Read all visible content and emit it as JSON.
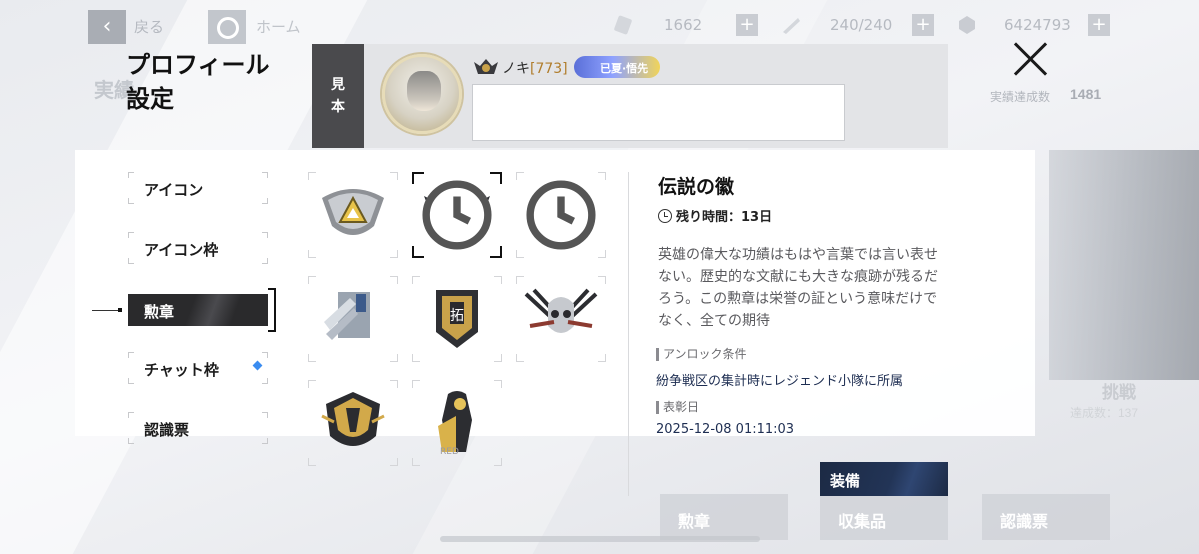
{
  "top_bar": {
    "back_label": "戻る",
    "home_label": "ホーム",
    "resource_1": "1662",
    "resource_2": "240/240",
    "resource_3": "6424793"
  },
  "background": {
    "left_title": "実績",
    "achievement_label": "実績達成数",
    "achievement_count": "1481",
    "challenge_label": "挑戦",
    "challenge_count_label": "達成数：137",
    "bottom_tabs": [
      "勲章",
      "収集品",
      "認識票"
    ]
  },
  "modal": {
    "title_line1": "プロフィール",
    "title_line2": "設定"
  },
  "preview": {
    "tag_line1": "見",
    "tag_line2": "本",
    "player_name": "ノキ",
    "player_level": "[773]",
    "rank_badge": "已夏·悟先"
  },
  "nav": {
    "items": [
      "アイコン",
      "アイコン枠",
      "勲章",
      "チャット枠",
      "認識票"
    ],
    "active_index": 2
  },
  "medals": [
    {
      "name": "medal-triangle-shield",
      "timed": false,
      "selected": false
    },
    {
      "name": "medal-legend-wings",
      "timed": true,
      "selected": true
    },
    {
      "name": "medal-legend-bronze",
      "timed": true,
      "selected": false
    },
    {
      "name": "medal-blue-shield",
      "timed": false,
      "selected": false
    },
    {
      "name": "medal-gold-plate",
      "timed": false,
      "selected": false
    },
    {
      "name": "medal-skull-swords",
      "timed": false,
      "selected": false
    },
    {
      "name": "medal-gold-crest",
      "timed": false,
      "selected": false
    },
    {
      "name": "medal-hooded-figure",
      "timed": false,
      "selected": false
    }
  ],
  "detail": {
    "title": "伝説の徽",
    "timer": "残り時間：13日",
    "description": "英雄の偉大な功績はもはや言葉では言い表せない。歴史的な文献にも大きな痕跡が残るだろう。この勲章は栄誉の証という意味だけでなく、全ての期待",
    "unlock_label": "アンロック条件",
    "unlock_value": "紛争戦区の集計時にレジェンド小隊に所属",
    "date_label": "表彰日",
    "date_value": "2025-12-08 01:11:03",
    "equip_label": "装備"
  },
  "colors": {
    "accent_dark": "#2a2a2c",
    "equip_navy": "#223456",
    "new_dot": "#3a8cf0",
    "level_gold": "#b07d2c"
  }
}
